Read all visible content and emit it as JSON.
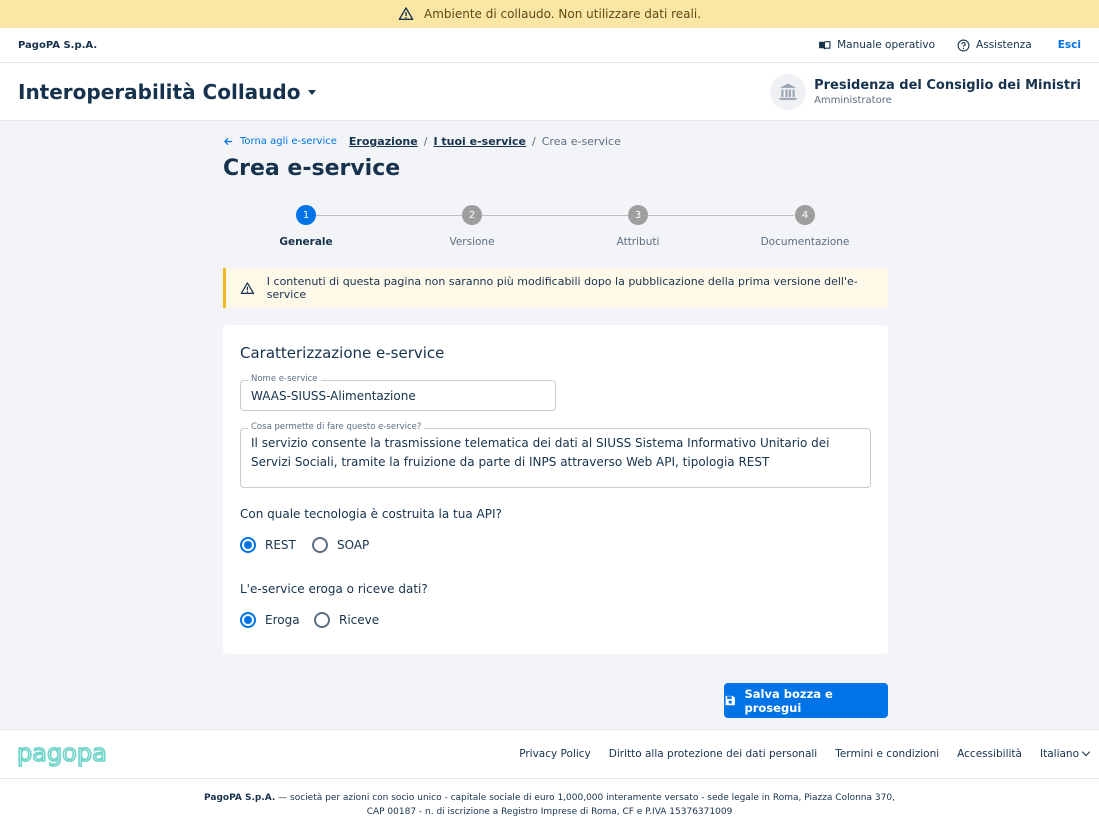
{
  "env_banner": {
    "text": "Ambiente di collaudo. Non utilizzare dati reali."
  },
  "topbar": {
    "brand": "PagoPA S.p.A.",
    "manual": "Manuale operativo",
    "help": "Assistenza",
    "logout": "Esci"
  },
  "header": {
    "product": "Interoperabilità Collaudo",
    "party_name": "Presidenza del Consiglio dei Ministri",
    "party_role": "Amministratore"
  },
  "breadcrumb": {
    "back": "Torna agli e-service",
    "items": [
      "Erogazione",
      "I tuoi e-service",
      "Crea e-service"
    ],
    "separator": "/"
  },
  "page_title": "Crea e-service",
  "stepper": {
    "steps": [
      {
        "number": "1",
        "label": "Generale",
        "active": true
      },
      {
        "number": "2",
        "label": "Versione",
        "active": false
      },
      {
        "number": "3",
        "label": "Attributi",
        "active": false
      },
      {
        "number": "4",
        "label": "Documentazione",
        "active": false
      }
    ]
  },
  "alert": {
    "text": "I contenuti di questa pagina non saranno più modificabili dopo la pubblicazione della prima versione dell'e-service"
  },
  "form": {
    "section_title": "Caratterizzazione e-service",
    "name_label": "Nome e-service",
    "name_value": "WAAS-SIUSS-Alimentazione",
    "desc_label": "Cosa permette di fare questo e-service?",
    "desc_value": "Il servizio consente la trasmissione telematica dei dati al SIUSS Sistema Informativo Unitario dei Servizi Sociali, tramite la fruizione da parte di INPS attraverso Web API, tipologia REST",
    "tech_question": "Con quale tecnologia è costruita la tua API?",
    "tech_options": [
      "REST",
      "SOAP"
    ],
    "tech_selected": "REST",
    "mode_question": "L'e-service eroga o riceve dati?",
    "mode_options": [
      "Eroga",
      "Riceve"
    ],
    "mode_selected": "Eroga"
  },
  "submit_label": "Salva bozza e prosegui",
  "footer": {
    "logo_text": "pagopa",
    "links": [
      "Privacy Policy",
      "Diritto alla protezione dei dati personali",
      "Termini e condizioni",
      "Accessibilità"
    ],
    "language": "Italiano",
    "legal_company": "PagoPA S.p.A.",
    "legal_line1": " — società per azioni con socio unico - capitale sociale di euro 1,000,000 interamente versato - sede legale in Roma, Piazza Colonna 370,",
    "legal_line2": "CAP 00187 - n. di iscrizione a Registro Imprese di Roma, CF e P.IVA 15376371009"
  },
  "colors": {
    "primary": "#0073e6",
    "text": "#17324d",
    "banner": "#fbe6a4",
    "warning": "#f2b824"
  }
}
